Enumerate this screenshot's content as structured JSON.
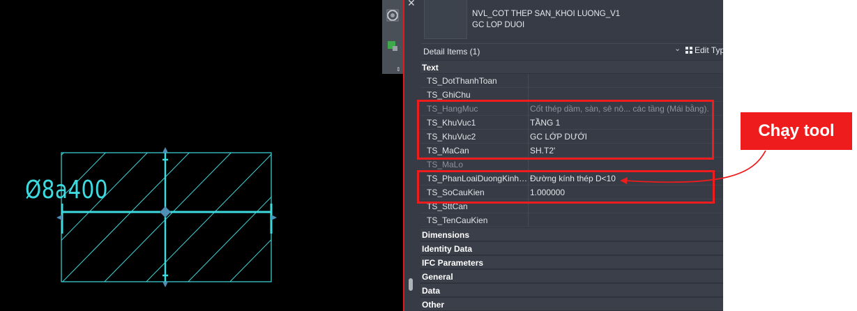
{
  "viewport": {
    "rebar_label": "Ø8a400",
    "colors": {
      "background": "#000000",
      "geometry": "#3ddbe0",
      "grip": "#4f8fb5"
    }
  },
  "toolbar": {
    "icons": [
      "view-cube-icon",
      "render-icon",
      "expand-icon"
    ]
  },
  "palette": {
    "close_glyph": "✕",
    "type_name_line1": "NVL_COT THEP SAN_KHOI LUONG_V1",
    "type_name_line2": "GC LOP DUOI",
    "selector": {
      "label": "Detail Items (1)",
      "dropdown_glyph": "⌄",
      "edit_type_label": "Edit Typ"
    },
    "text_group": {
      "title": "Text",
      "rows": [
        {
          "name": "TS_DotThanhToan",
          "value": ""
        },
        {
          "name": "TS_GhiChu",
          "value": ""
        },
        {
          "name": "TS_HangMuc",
          "value": "Cốt thép dầm, sàn, sê nô... các tầng (Mái bằng)."
        },
        {
          "name": "TS_KhuVuc1",
          "value": "TẦNG 1"
        },
        {
          "name": "TS_KhuVuc2",
          "value": "GC LỚP DƯỚI"
        },
        {
          "name": "TS_MaCan",
          "value": "SH.T2'"
        },
        {
          "name": "TS_MaLo",
          "value": ""
        },
        {
          "name": "TS_PhanLoaiDuongKinhTh...",
          "value": "Đường kính thép D<10"
        },
        {
          "name": "TS_SoCauKien",
          "value": "1.000000"
        },
        {
          "name": "TS_SttCan",
          "value": ""
        },
        {
          "name": "TS_TenCauKien",
          "value": ""
        }
      ]
    },
    "groups": [
      "Dimensions",
      "Identity Data",
      "IFC Parameters",
      "General",
      "Data",
      "Other"
    ]
  },
  "annotation": {
    "callout_text": "Chạy tool",
    "color": "#ee1c1c"
  }
}
